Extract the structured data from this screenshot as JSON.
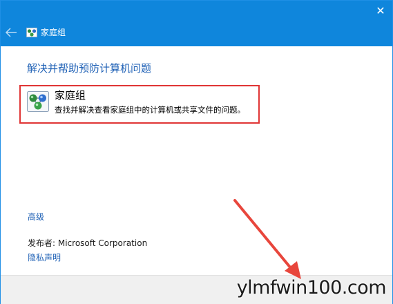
{
  "window": {
    "title": "家庭组",
    "close_glyph": "✕"
  },
  "main": {
    "heading": "解决并帮助预防计算机问题",
    "item": {
      "title": "家庭组",
      "description": "查找并解决查看家庭组中的计算机或共享文件的问题。",
      "icon": "homegroup-icon"
    },
    "advanced_link": "高级",
    "publisher": "发布者:  Microsoft Corporation",
    "privacy_link": "隐私声明"
  },
  "watermark": "ylmfwin100.com",
  "colors": {
    "titlebar": "#0f86dc",
    "link": "#1b5eb4",
    "highlight_box": "#e03535",
    "annotation_arrow": "#e8463c"
  }
}
